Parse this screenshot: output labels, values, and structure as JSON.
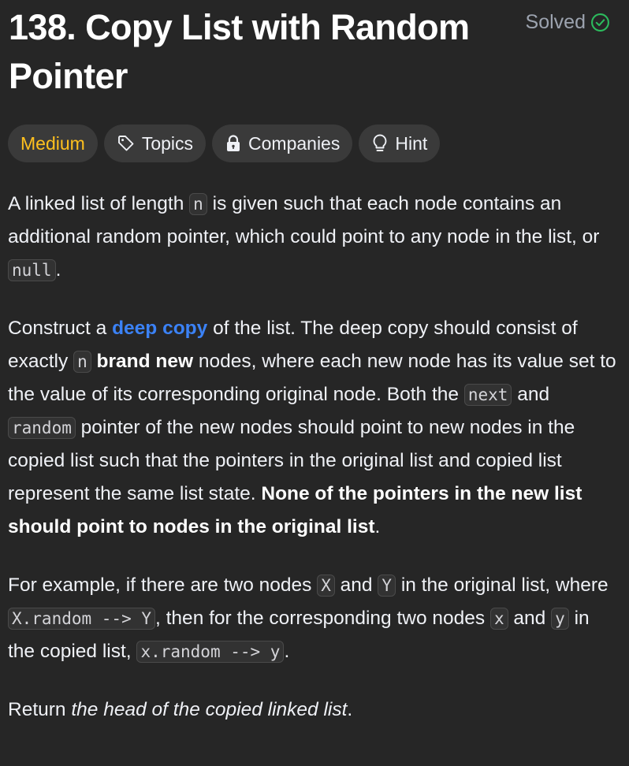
{
  "problem": {
    "title": "138. Copy List with Random Pointer",
    "status": "Solved"
  },
  "tags": {
    "difficulty": "Medium",
    "topics": "Topics",
    "companies": "Companies",
    "hint": "Hint"
  },
  "colors": {
    "background": "#262626",
    "medium": "#ffc01e",
    "link": "#3b82f6",
    "chip": "#3a3a3a"
  },
  "icons": {
    "solved": "check-circle-icon",
    "topics": "tag-icon",
    "companies": "lock-icon",
    "hint": "lightbulb-icon"
  },
  "description": {
    "p1": {
      "t1": "A linked list of length ",
      "c1": "n",
      "t2": " is given such that each node contains an additional random pointer, which could point to any node in the list, or ",
      "c2": "null",
      "t3": "."
    },
    "p2": {
      "t1": "Construct a ",
      "link": "deep copy",
      "t2": " of the list. The deep copy should consist of exactly ",
      "c1": "n",
      "t3": " ",
      "b1": "brand new",
      "t4": " nodes, where each new node has its value set to the value of its corresponding original node. Both the ",
      "c2": "next",
      "t5": " and ",
      "c3": "random",
      "t6": " pointer of the new nodes should point to new nodes in the copied list such that the pointers in the original list and copied list represent the same list state. ",
      "b2": "None of the pointers in the new list should point to nodes in the original list",
      "t7": "."
    },
    "p3": {
      "t1": "For example, if there are two nodes ",
      "c1": "X",
      "t2": " and ",
      "c2": "Y",
      "t3": " in the original list, where ",
      "c3": "X.random --> Y",
      "t4": ", then for the corresponding two nodes ",
      "c4": "x",
      "t5": " and ",
      "c5": "y",
      "t6": " in the copied list, ",
      "c6": "x.random --> y",
      "t7": "."
    },
    "p4": {
      "t1": "Return ",
      "e1": "the head of the copied linked list",
      "t2": "."
    }
  }
}
